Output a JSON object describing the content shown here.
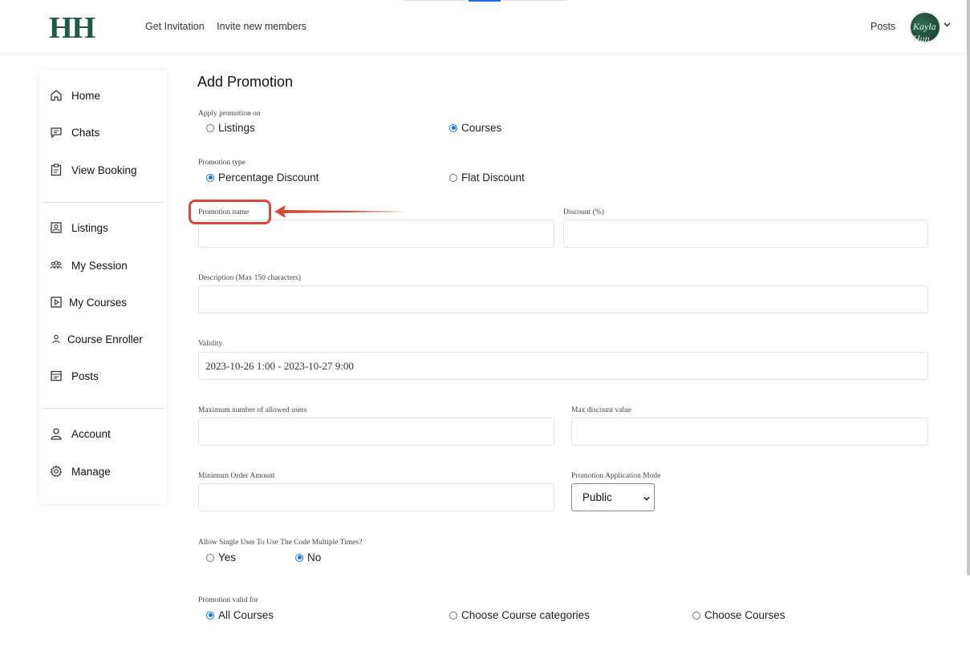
{
  "header": {
    "logo": "HH",
    "nav": [
      "Get Invitation",
      "Invite new members"
    ],
    "posts": "Posts",
    "avatar_text": "Kayla Hun"
  },
  "sidebar": {
    "group1": [
      {
        "label": "Home",
        "icon": "home-icon"
      },
      {
        "label": "Chats",
        "icon": "chat-icon"
      },
      {
        "label": "View Booking",
        "icon": "clipboard-icon"
      }
    ],
    "group2": [
      {
        "label": "Listings",
        "icon": "listing-icon"
      },
      {
        "label": "My Session",
        "icon": "people-icon"
      },
      {
        "label": "My Courses",
        "icon": "play-icon"
      },
      {
        "label": "Course Enroller",
        "icon": "user-icon"
      },
      {
        "label": "Posts",
        "icon": "posts-icon"
      }
    ],
    "group3": [
      {
        "label": "Account",
        "icon": "account-icon"
      },
      {
        "label": "Manage",
        "icon": "gear-icon"
      }
    ]
  },
  "form": {
    "title": "Add Promotion",
    "apply_on": {
      "label": "Apply promotion on",
      "options": [
        "Listings",
        "Courses"
      ],
      "selected": "Courses"
    },
    "promo_type": {
      "label": "Promotion type",
      "options": [
        "Percentage Discount",
        "Flat Discount"
      ],
      "selected": "Percentage Discount"
    },
    "promo_name": {
      "label": "Promotion name",
      "value": ""
    },
    "discount": {
      "label": "Discount (%)",
      "value": ""
    },
    "description": {
      "label": "Description (Max 150 characters)",
      "value": ""
    },
    "validity": {
      "label": "Validity",
      "value": "2023-10-26 1:00 - 2023-10-27 9:00"
    },
    "max_users": {
      "label": "Maximum number of allowed users",
      "value": ""
    },
    "max_discount": {
      "label": "Max discount value",
      "value": ""
    },
    "min_order": {
      "label": "Minimum Order Amount",
      "value": ""
    },
    "app_mode": {
      "label": "Promotion Application Mode",
      "value": "Public"
    },
    "multi_use": {
      "label": "Allow Single User To Use The Code Multiple Times?",
      "options": [
        "Yes",
        "No"
      ],
      "selected": "No"
    },
    "valid_for": {
      "label": "Promotion valid for",
      "options": [
        "All Courses",
        "Choose Course categories",
        "Choose Courses"
      ],
      "selected": "All Courses"
    }
  },
  "colors": {
    "brand": "#1f5a44",
    "accent": "#1a73e8",
    "annotation": "#d84835"
  }
}
